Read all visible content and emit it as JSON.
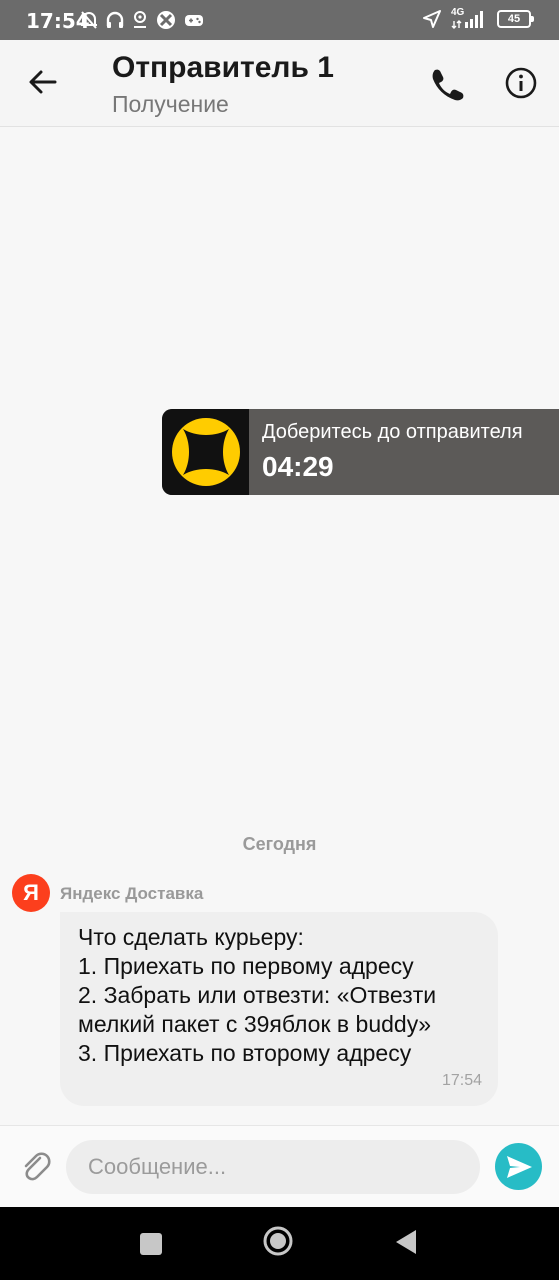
{
  "status_bar": {
    "time": "17:54",
    "network": "4G",
    "battery": "45",
    "icons": [
      "mute-bell-icon",
      "headphones-icon",
      "location-icon",
      "app-icon",
      "gamepad-icon",
      "navigation-arrow-icon",
      "signal-icon",
      "battery-icon"
    ]
  },
  "header": {
    "title": "Отправитель 1",
    "subtitle": "Получение",
    "icons": [
      "back-arrow-icon",
      "phone-icon",
      "info-icon"
    ]
  },
  "timer_card": {
    "label": "Доберитесь до отправителя",
    "value": "04:29",
    "accent_color": "#ffcc00",
    "icon": "yandex-go-logo-icon"
  },
  "chat": {
    "date_separator": "Сегодня",
    "messages": [
      {
        "sender": "Яндекс Доставка",
        "avatar_letter": "Я",
        "avatar_color": "#fc3f1d",
        "lines": [
          "Что сделать курьеру:",
          "1. Приехать по первому адресу",
          "2. Забрать или отвезти: «Отвезти",
          "мелкий пакет с 39яблок в buddy»",
          "3. Приехать по второму адресу"
        ],
        "time": "17:54"
      }
    ]
  },
  "composer": {
    "placeholder": "Сообщение...",
    "value": "",
    "send_color": "#27bcc6",
    "icons": [
      "attach-paperclip-icon",
      "send-icon"
    ]
  },
  "nav_bar": {
    "icons": [
      "recents-square-icon",
      "home-circle-icon",
      "back-triangle-icon"
    ]
  }
}
